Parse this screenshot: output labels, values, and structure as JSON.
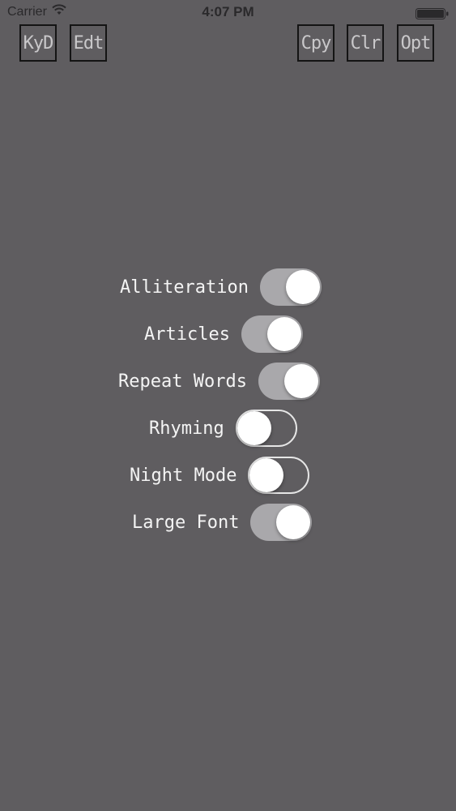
{
  "status_bar": {
    "carrier": "Carrier",
    "time": "4:07 PM",
    "wifi_icon": "wifi-icon",
    "battery_icon": "battery-icon",
    "battery_level": 1.0
  },
  "toolbar": {
    "left": [
      {
        "label": "KyD"
      },
      {
        "label": "Edt"
      }
    ],
    "right": [
      {
        "label": "Cpy"
      },
      {
        "label": "Clr"
      },
      {
        "label": "Opt"
      }
    ]
  },
  "options": [
    {
      "label": "Alliteration",
      "on": true
    },
    {
      "label": "Articles",
      "on": true
    },
    {
      "label": "Repeat Words",
      "on": true
    },
    {
      "label": "Rhyming",
      "on": false
    },
    {
      "label": "Night Mode",
      "on": false
    },
    {
      "label": "Large Font",
      "on": true
    }
  ],
  "colors": {
    "background": "#5f5d60",
    "toggle_on": "#a9a8ab",
    "toggle_knob": "#ffffff",
    "label_text": "#f4f4f4",
    "button_text": "#c9c8ca",
    "button_border": "#141414"
  }
}
